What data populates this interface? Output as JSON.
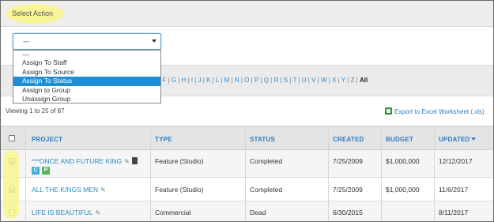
{
  "action_bar": {
    "title": "Select Action"
  },
  "select": {
    "value": "---"
  },
  "dropdown": {
    "options": [
      "---",
      "Assign To Staff",
      "Assign To Source",
      "Assign To Status",
      "Assign to Group",
      "Unassign Group"
    ],
    "selected_index": 3
  },
  "alpha_filter": {
    "letters": [
      "F",
      "G",
      "H",
      "I",
      "J",
      "K",
      "L",
      "M",
      "N",
      "O",
      "P",
      "Q",
      "R",
      "S",
      "T",
      "U",
      "V",
      "W",
      "X",
      "Y",
      "Z"
    ],
    "all_label": "All"
  },
  "viewing_text": "Viewing 1 to 25 of 87",
  "export_label": "Export to Excel Worksheet (.xls)",
  "table": {
    "headers": {
      "project": "PROJECT",
      "type": "TYPE",
      "status": "STATUS",
      "created": "CREATED",
      "budget": "BUDGET",
      "updated": "UPDATED"
    },
    "rows": [
      {
        "checked": true,
        "project": "***ONCE AND FUTURE KING",
        "type": "Feature (Studio)",
        "status": "Completed",
        "created": "7/25/2009",
        "budget": "$1,000,000",
        "updated": "12/12/2017",
        "tags": [
          "C",
          "P"
        ]
      },
      {
        "checked": true,
        "project": "ALL THE KINGS MEN",
        "type": "Feature (Studio)",
        "status": "Completed",
        "created": "7/25/2009",
        "budget": "$1,000,000",
        "updated": "11/6/2017",
        "tags": []
      },
      {
        "checked": false,
        "project": "LIFE IS BEAUTIFUL",
        "type": "Commercial",
        "status": "Dead",
        "created": "6/30/2015",
        "budget": "",
        "updated": "8/11/2017",
        "tags": []
      }
    ]
  },
  "colors": {
    "link": "#2e8bc9",
    "highlight": "#f7f58e",
    "selected_option": "#1e8fd6",
    "tag_c": "#3fb0d8",
    "tag_p": "#5bb35b"
  }
}
